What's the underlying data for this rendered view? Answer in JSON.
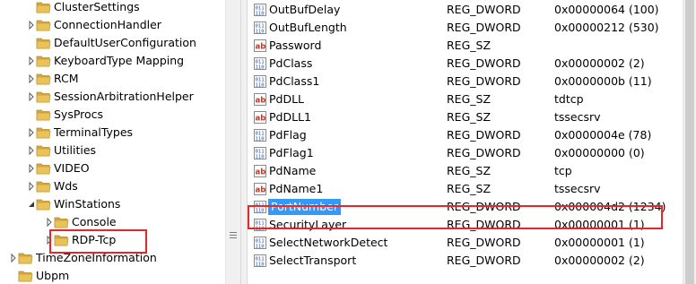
{
  "tree": {
    "items": [
      {
        "label": "ClusterSettings",
        "expandable": false,
        "depth": 1
      },
      {
        "label": "ConnectionHandler",
        "expandable": true,
        "depth": 1
      },
      {
        "label": "DefaultUserConfiguration",
        "expandable": false,
        "depth": 1
      },
      {
        "label": "KeyboardType Mapping",
        "expandable": true,
        "depth": 1
      },
      {
        "label": "RCM",
        "expandable": true,
        "depth": 1
      },
      {
        "label": "SessionArbitrationHelper",
        "expandable": true,
        "depth": 1
      },
      {
        "label": "SysProcs",
        "expandable": false,
        "depth": 1
      },
      {
        "label": "TerminalTypes",
        "expandable": true,
        "depth": 1
      },
      {
        "label": "Utilities",
        "expandable": true,
        "depth": 1
      },
      {
        "label": "VIDEO",
        "expandable": true,
        "depth": 1
      },
      {
        "label": "Wds",
        "expandable": true,
        "depth": 1
      },
      {
        "label": "WinStations",
        "expandable": true,
        "expanded": true,
        "depth": 1
      },
      {
        "label": "Console",
        "expandable": true,
        "depth": 2
      },
      {
        "label": "RDP-Tcp",
        "expandable": true,
        "depth": 2,
        "highlighted": true
      },
      {
        "label": "TimeZoneInformation",
        "expandable": true,
        "depth": 0
      },
      {
        "label": "Ubpm",
        "expandable": false,
        "depth": 0
      }
    ]
  },
  "values": {
    "rows": [
      {
        "icon": "binary-value-icon",
        "name": "OutBufDelay",
        "type": "REG_DWORD",
        "data": "0x00000064 (100)"
      },
      {
        "icon": "binary-value-icon",
        "name": "OutBufLength",
        "type": "REG_DWORD",
        "data": "0x00000212 (530)"
      },
      {
        "icon": "string-value-icon",
        "name": "Password",
        "type": "REG_SZ",
        "data": ""
      },
      {
        "icon": "binary-value-icon",
        "name": "PdClass",
        "type": "REG_DWORD",
        "data": "0x00000002 (2)"
      },
      {
        "icon": "binary-value-icon",
        "name": "PdClass1",
        "type": "REG_DWORD",
        "data": "0x0000000b (11)"
      },
      {
        "icon": "string-value-icon",
        "name": "PdDLL",
        "type": "REG_SZ",
        "data": "tdtcp"
      },
      {
        "icon": "string-value-icon",
        "name": "PdDLL1",
        "type": "REG_SZ",
        "data": "tssecsrv"
      },
      {
        "icon": "binary-value-icon",
        "name": "PdFlag",
        "type": "REG_DWORD",
        "data": "0x0000004e (78)"
      },
      {
        "icon": "binary-value-icon",
        "name": "PdFlag1",
        "type": "REG_DWORD",
        "data": "0x00000000 (0)"
      },
      {
        "icon": "string-value-icon",
        "name": "PdName",
        "type": "REG_SZ",
        "data": "tcp"
      },
      {
        "icon": "string-value-icon",
        "name": "PdName1",
        "type": "REG_SZ",
        "data": "tssecsrv"
      },
      {
        "icon": "binary-value-icon",
        "name": "PortNumber",
        "type": "REG_DWORD",
        "data": "0x000004d2 (1234)",
        "selected": true
      },
      {
        "icon": "binary-value-icon",
        "name": "SecurityLayer",
        "type": "REG_DWORD",
        "data": "0x00000001 (1)"
      },
      {
        "icon": "binary-value-icon",
        "name": "SelectNetworkDetect",
        "type": "REG_DWORD",
        "data": "0x00000001 (1)"
      },
      {
        "icon": "binary-value-icon",
        "name": "SelectTransport",
        "type": "REG_DWORD",
        "data": "0x00000002 (2)"
      }
    ]
  },
  "colors": {
    "selection": "#3399ff",
    "annotation_red": "#e8262a",
    "folder_yellow": "#e8c35a"
  }
}
